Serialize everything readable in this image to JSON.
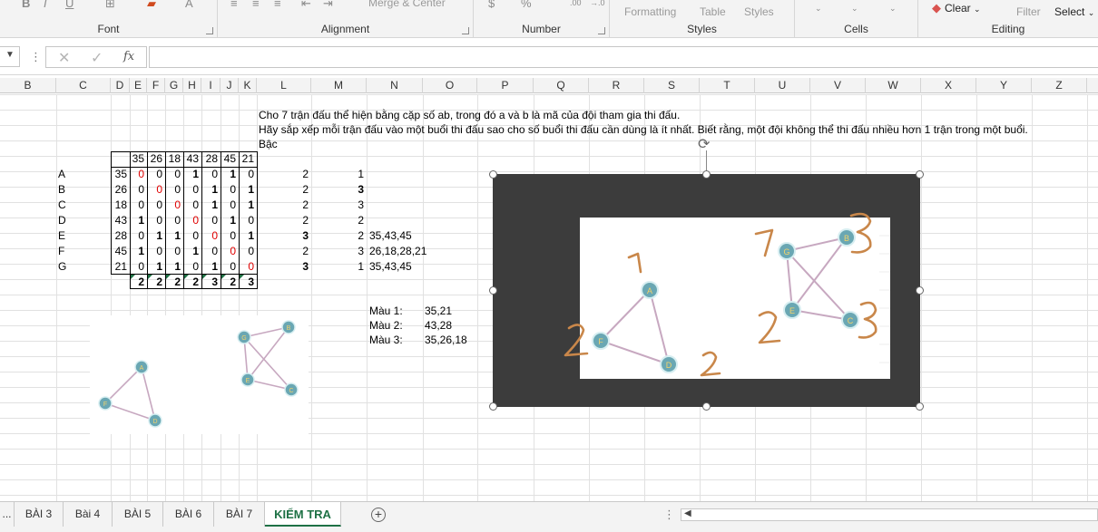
{
  "ribbon": {
    "groups": {
      "font": "Font",
      "alignment": "Alignment",
      "number": "Number",
      "styles": "Styles",
      "cells": "Cells",
      "editing": "Editing"
    },
    "merge_center": "Merge & Center",
    "conditional_formatting": "Formatting",
    "format_as_table": "Table",
    "cell_styles": "Styles",
    "clear": "Clear",
    "filter": "Filter",
    "select": "Select"
  },
  "formula_bar": {
    "fx": "fx",
    "value": ""
  },
  "columns": [
    "B",
    "C",
    "D",
    "E",
    "F",
    "G",
    "H",
    "I",
    "J",
    "K",
    "L",
    "M",
    "N",
    "O",
    "P",
    "Q",
    "R",
    "S",
    "T",
    "U",
    "V",
    "W",
    "X",
    "Y",
    "Z"
  ],
  "sheet": {
    "intro_line1": "Cho 7 trận đấu thể hiện bằng cặp số ab, trong đó a và b là mã của đội tham gia thi đấu.",
    "intro_line2": "Hãy sắp xếp mỗi trận đấu vào một buổi thi đấu sao cho số buổi thi đấu cần dùng là ít nhất. Biết rằng, một đội không thể thi đấu nhiều hơn 1 trận trong một buổi.",
    "bac_label": "Bậc",
    "matrix_headers": [
      "35",
      "26",
      "18",
      "43",
      "28",
      "45",
      "21"
    ],
    "rows": [
      {
        "label": "A",
        "code": "35",
        "cells": [
          "0",
          "0",
          "0",
          "1",
          "0",
          "1",
          "0"
        ],
        "l": "2",
        "m": "1",
        "n": ""
      },
      {
        "label": "B",
        "code": "26",
        "cells": [
          "0",
          "0",
          "0",
          "0",
          "1",
          "0",
          "1"
        ],
        "l": "2",
        "m": "3",
        "n": ""
      },
      {
        "label": "C",
        "code": "18",
        "cells": [
          "0",
          "0",
          "0",
          "0",
          "1",
          "0",
          "1"
        ],
        "l": "2",
        "m": "3",
        "n": ""
      },
      {
        "label": "D",
        "code": "43",
        "cells": [
          "1",
          "0",
          "0",
          "0",
          "0",
          "1",
          "0"
        ],
        "l": "2",
        "m": "2",
        "n": ""
      },
      {
        "label": "E",
        "code": "28",
        "cells": [
          "0",
          "1",
          "1",
          "0",
          "0",
          "0",
          "1"
        ],
        "l": "3",
        "m": "2",
        "n": "35,43,45"
      },
      {
        "label": "F",
        "code": "45",
        "cells": [
          "1",
          "0",
          "0",
          "1",
          "0",
          "0",
          "0"
        ],
        "l": "2",
        "m": "3",
        "n": "26,18,28,21"
      },
      {
        "label": "G",
        "code": "21",
        "cells": [
          "0",
          "1",
          "1",
          "0",
          "1",
          "0",
          "0"
        ],
        "l": "3",
        "m": "1",
        "n": "35,43,45"
      }
    ],
    "degree_row": [
      "2",
      "2",
      "2",
      "2",
      "3",
      "2",
      "3"
    ],
    "colors": [
      {
        "label": "Màu 1:",
        "value": "35,21"
      },
      {
        "label": "Màu 2:",
        "value": "43,28"
      },
      {
        "label": "Màu 3:",
        "value": "35,26,18"
      }
    ]
  },
  "graph": {
    "nodes_small": [
      "A",
      "D",
      "F",
      "G",
      "B",
      "E",
      "C"
    ],
    "node_color": "#6aa7b3",
    "edge_color": "#c7a8c0",
    "annotation_color": "#c9874a",
    "annotations": [
      "1",
      "2",
      "2",
      "7",
      "3",
      "2",
      "3"
    ]
  },
  "tabs": [
    "...",
    "BÀI 3",
    "Bài 4",
    "BÀI 5",
    "BÀI 6",
    "BÀI 7",
    "KIỂM TRA"
  ]
}
